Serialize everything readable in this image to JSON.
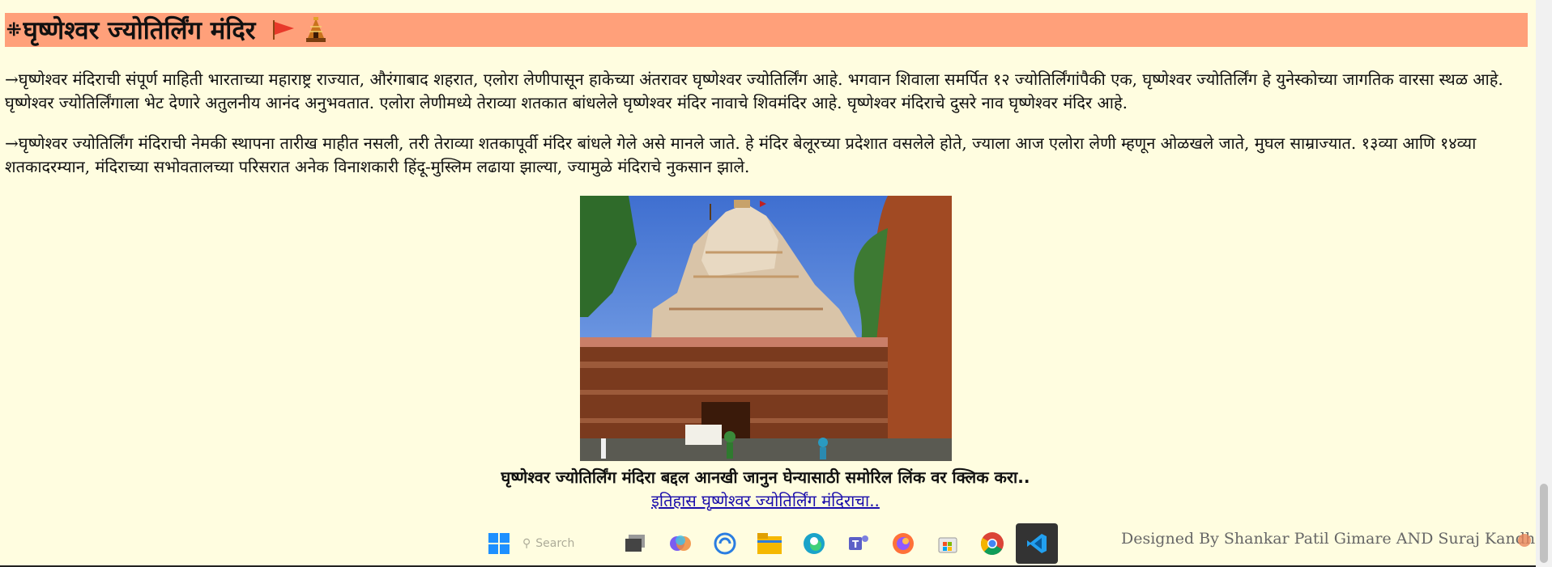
{
  "heading": {
    "hash": "⁜",
    "title": "घृष्णेश्वर ज्योतिर्लिंग मंदिर"
  },
  "paragraphs": [
    "→घृष्णेश्वर मंदिराची संपूर्ण माहिती भारताच्या महाराष्ट्र राज्यात, औरंगाबाद शहरात, एलोरा लेणीपासून हाकेच्या अंतरावर घृष्णेश्वर ज्योतिर्लिंग आहे. भगवान शिवाला समर्पित १२ ज्योतिर्लिंगांपैकी एक, घृष्णेश्वर ज्योतिर्लिंग हे युनेस्कोच्या जागतिक वारसा स्थळ आहे. घृष्णेश्वर ज्योतिर्लिंगाला भेट देणारे अतुलनीय आनंद अनुभवतात. एलोरा लेणीमध्ये तेराव्या शतकात बांधलेले घृष्णेश्वर मंदिर नावाचे शिवमंदिर आहे. घृष्णेश्वर मंदिराचे दुसरे नाव घृष्णेश्वर मंदिर आहे.",
    "→घृष्णेश्वर ज्योतिर्लिंग मंदिराची नेमकी स्थापना तारीख माहीत नसली, तरी तेराव्या शतकापूर्वी मंदिर बांधले गेले असे मानले जाते. हे मंदिर बेलूरच्या प्रदेशात वसलेले होते, ज्याला आज एलोरा लेणी म्हणून ओळखले जाते, मुघल साम्राज्यात. १३व्या आणि १४व्या शतकादरम्यान, मंदिराच्या सभोवतालच्या परिसरात अनेक विनाशकारी हिंदू-मुस्लिम लढाया झाल्या, ज्यामुळे मंदिराचे नुकसान झाले."
  ],
  "caption": "घृष्णेश्वर ज्योतिर्लिंग मंदिरा बद्दल आनखी जानुन घेन्यासाठी समोरिल लिंक वर क्लिक करा..",
  "link_text": "इतिहास घृष्णेश्वर ज्योतिर्लिंग मंदिराचा..",
  "footer_credit": "Designed By Shankar Patil Gimare AND Suraj Kandharkar",
  "taskbar": {
    "search_label": "Search",
    "apps": [
      "start-icon",
      "task-view-icon",
      "copilot-icon",
      "edge-sync-icon",
      "file-explorer-icon",
      "edge-icon",
      "teams-icon",
      "firefox-icon",
      "store-icon",
      "chrome-icon",
      "vscode-icon"
    ]
  },
  "colors": {
    "background": "#fffde0",
    "heading_bar": "#ffa07a",
    "link": "#1a0dab",
    "flag": "#e8392a"
  }
}
